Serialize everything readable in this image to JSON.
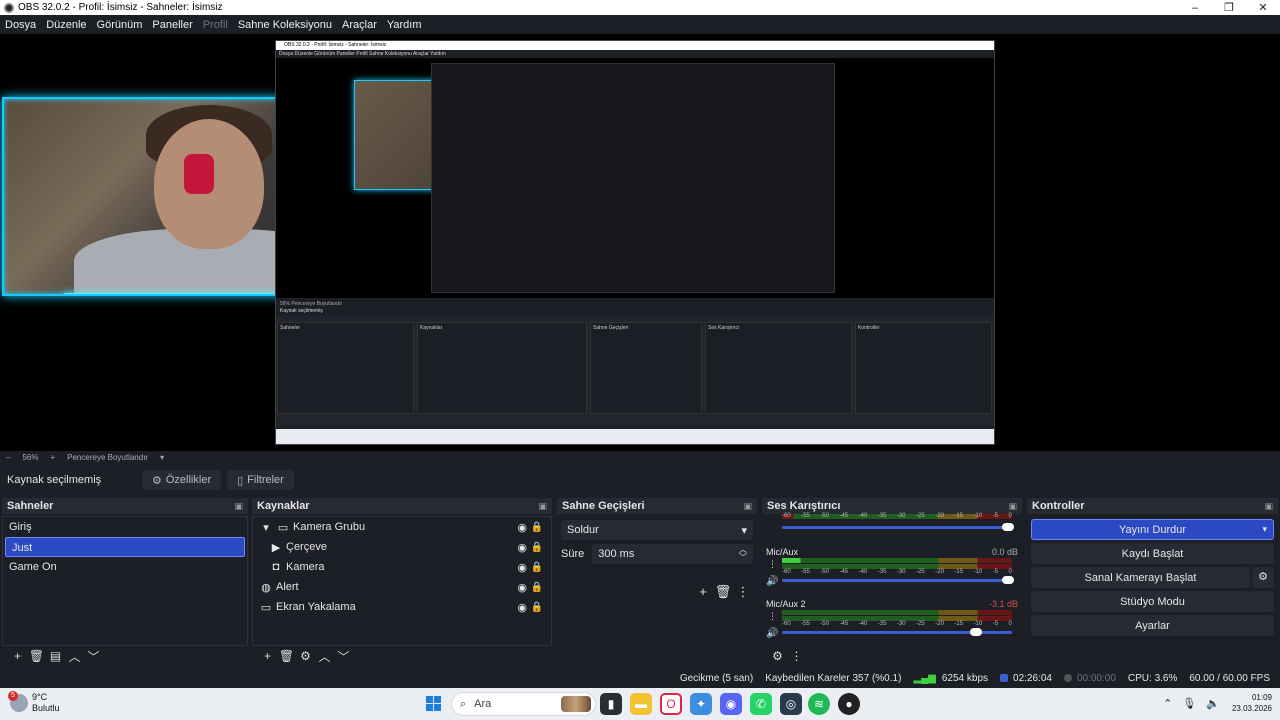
{
  "window": {
    "title": "OBS 32.0.2 - Profil: İsimsiz - Sahneler: İsimsiz",
    "min": "–",
    "max": "❐",
    "close": "✕"
  },
  "menu": {
    "items": [
      "Dosya",
      "Düzenle",
      "Görünüm",
      "Paneller",
      "Profil",
      "Sahne Koleksiyonu",
      "Araçlar",
      "Yardım"
    ]
  },
  "zoom": {
    "minus": "–",
    "percent": "56%",
    "plus": "+",
    "mode": "Pencereye Boyutlandır",
    "chevron": "▾"
  },
  "context": {
    "label": "Kaynak seçilmemiş",
    "properties": "Özellikler",
    "filters": "Filtreler"
  },
  "scenes": {
    "title": "Sahneler",
    "items": [
      "Giriş",
      "Just",
      "Game On"
    ],
    "selected": "Just"
  },
  "sources": {
    "title": "Kaynaklar",
    "items": [
      "Kamera Grubu",
      "Çerçeve",
      "Kamera",
      "Alert",
      "Ekran Yakalama"
    ]
  },
  "transitions": {
    "title": "Sahne Geçişleri",
    "selected": "Soldur",
    "duration_label": "Süre",
    "duration_value": "300 ms"
  },
  "mixer": {
    "title": "Ses Karıştırıcı",
    "channels": [
      {
        "name": "",
        "db": ""
      },
      {
        "name": "Mic/Aux",
        "db": "0.0 dB"
      },
      {
        "name": "Mic/Aux 2",
        "db": "-3.1 dB"
      }
    ],
    "scale": [
      "-60",
      "-55",
      "-50",
      "-45",
      "-40",
      "-35",
      "-30",
      "-25",
      "-20",
      "-15",
      "-10",
      "-5",
      "0"
    ]
  },
  "controls": {
    "title": "Kontroller",
    "stop_stream": "Yayını Durdur",
    "start_record": "Kaydı Başlat",
    "start_vcam": "Sanal Kamerayı Başlat",
    "studio_mode": "Stüdyo Modu",
    "settings": "Ayarlar"
  },
  "status": {
    "delay": "Gecikme (5 san)",
    "dropped": "Kaybedilen Kareler 357 (%0.1)",
    "bitrate": "6254 kbps",
    "live_time": "02:26:04",
    "rec_time": "00:00:00",
    "cpu": "CPU: 3.6%",
    "fps": "60.00 / 60.00 FPS"
  },
  "taskbar": {
    "weather_badge": "5",
    "temp": "9°C",
    "condition": "Bulutlu",
    "search_placeholder": "Ara",
    "time": "01:09",
    "date": "23.03.2026"
  },
  "nested": {
    "title": "OBS 32.0.2 - Profil: İsimsiz - Sahneler: İsimsiz",
    "menu": "Dosya   Düzenle   Görünüm   Paneller   Profil   Sahne Koleksiyonu   Araçlar   Yardım",
    "zoom": "56%   Pencereye Boyutlandır",
    "context": "Kaynak seçilmemiş",
    "scenes": "Sahneler",
    "sources": "Kaynaklar",
    "transitions": "Sahne Geçişleri",
    "mixer": "Ses Karıştırıcı",
    "controls": "Kontroller"
  },
  "colors": {
    "accent": "#2b49c2",
    "glow": "#19d0ff",
    "meter_green": "#3fcf3f"
  }
}
